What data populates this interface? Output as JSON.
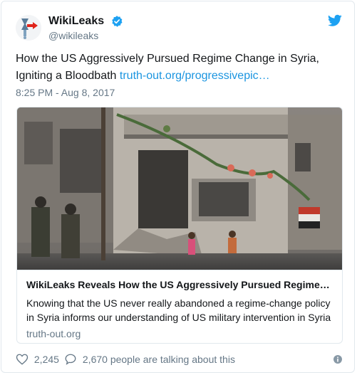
{
  "user": {
    "display_name": "WikiLeaks",
    "handle": "@wikileaks"
  },
  "tweet": {
    "text": "How the US Aggressively Pursued Regime Change in Syria, Igniting a Bloodbath ",
    "link_text": "truth-out.org/progressivepic…",
    "timestamp": "8:25 PM - Aug 8, 2017"
  },
  "card": {
    "title": "WikiLeaks Reveals How the US Aggressively Pursued Regime…",
    "description": "Knowing that the US never really abandoned a regime-change policy in Syria informs our understanding of US military intervention in Syria",
    "domain": "truth-out.org"
  },
  "footer": {
    "likes": "2,245",
    "talking": "2,670 people are talking about this"
  },
  "colors": {
    "link": "#1b95e0",
    "verified": "#1da1f2",
    "muted": "#657786",
    "border": "#e1e8ed"
  },
  "icons": [
    "hourglass-drip-avatar-icon",
    "verified-badge-icon",
    "twitter-bird-icon",
    "heart-icon",
    "speech-bubble-icon",
    "info-icon"
  ]
}
